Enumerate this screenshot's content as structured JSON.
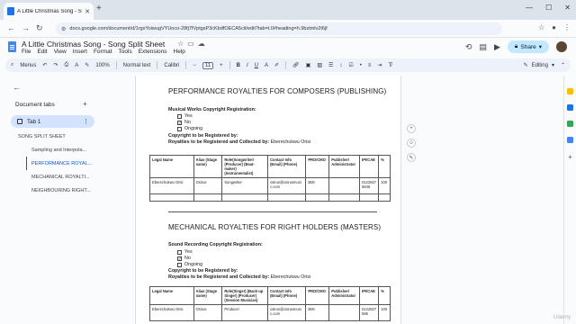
{
  "browser": {
    "tab_title": "A Little Christmas Song - Song",
    "url": "docs.google.com/document/d/1rgxYoiwugVYUoco-28fj7fVptgsP3cKbdfOECA5cit/edit?tab=t.0#heading=h.9bztmlv2t6jf"
  },
  "docs": {
    "title": "A Little Christmas Song - Song Split Sheet",
    "menus": [
      "File",
      "Edit",
      "View",
      "Insert",
      "Format",
      "Tools",
      "Extensions",
      "Help"
    ],
    "share_label": "Share",
    "toolbar": {
      "menus_label": "Menus",
      "zoom": "100%",
      "style": "Normal text",
      "font": "Calibri",
      "size": "11",
      "mode": "Editing"
    }
  },
  "sidebar": {
    "heading": "Document tabs",
    "tab_label": "Tab 1",
    "outline": [
      {
        "label": "SONG SPLIT SHEET",
        "level": 1,
        "active": false
      },
      {
        "label": "Sampling and Interpola...",
        "level": 2,
        "active": false
      },
      {
        "label": "PERFORMANCE ROYAL...",
        "level": 2,
        "active": true
      },
      {
        "label": "MECHANICAL ROYALTI...",
        "level": 2,
        "active": false
      },
      {
        "label": "NEIGHBOURING RIGHT...",
        "level": 2,
        "active": false
      }
    ]
  },
  "section1": {
    "heading": "PERFORMANCE ROYALTIES FOR COMPOSERS (PUBLISHING)",
    "reg_label": "Musical Works Copyright Registration:",
    "options": [
      {
        "label": "Yes",
        "checked": false
      },
      {
        "label": "No",
        "checked": true
      },
      {
        "label": "Ongoing",
        "checked": false
      }
    ],
    "registered_by": "Copyright to be Registered by:",
    "collected_by": "Royalties to be Registered and Collected by:",
    "collector": "Eberechukwu Orisi",
    "columns": [
      "Legal Name",
      "Alias (Stage name)",
      "Role(Songwriter/ (Producer) (Beat-maker) (Instrumentalist)",
      "Contact Info (Email) (Phone)",
      "PRO/CMO",
      "Publisher/ Administrator",
      "IPI/CAE",
      "%"
    ],
    "rows": [
      [
        "Eberechukwu Orisi",
        "Osirus",
        "Songwriter",
        "osirus@osirusmusic.com",
        "BMI",
        "",
        "01228275846",
        "100"
      ],
      [
        "",
        "",
        "",
        "",
        "",
        "",
        "",
        ""
      ]
    ]
  },
  "section2": {
    "heading": "MECHANICAL ROYALTIES FOR RIGHT HOLDERS (MASTERS)",
    "reg_label": "Sound Recording Copyright Registration:",
    "options": [
      {
        "label": "Yes",
        "checked": false
      },
      {
        "label": "No",
        "checked": true
      },
      {
        "label": "Ongoing",
        "checked": false
      }
    ],
    "registered_by": "Copyright to be Registered by:",
    "collected_by": "Royalties to be Registered and Collected by:",
    "collector": "Eberechukwu Orisi",
    "columns": [
      "Legal Name",
      "Alias (Stage name)",
      "Role(Singer) (Back-up Singer) (Producer) (Session Musician)",
      "Contact Info (Email) (Phone)",
      "PRO/CMO",
      "Publisher/ Administrator",
      "IPI/CAE",
      "%"
    ],
    "rows": [
      [
        "Eberechukwu Orisi",
        "Osirus",
        "Producer",
        "osirus@osirusmusic.com",
        "BMI",
        "",
        "0122827586",
        "100"
      ]
    ]
  },
  "watermark": "Udemy"
}
